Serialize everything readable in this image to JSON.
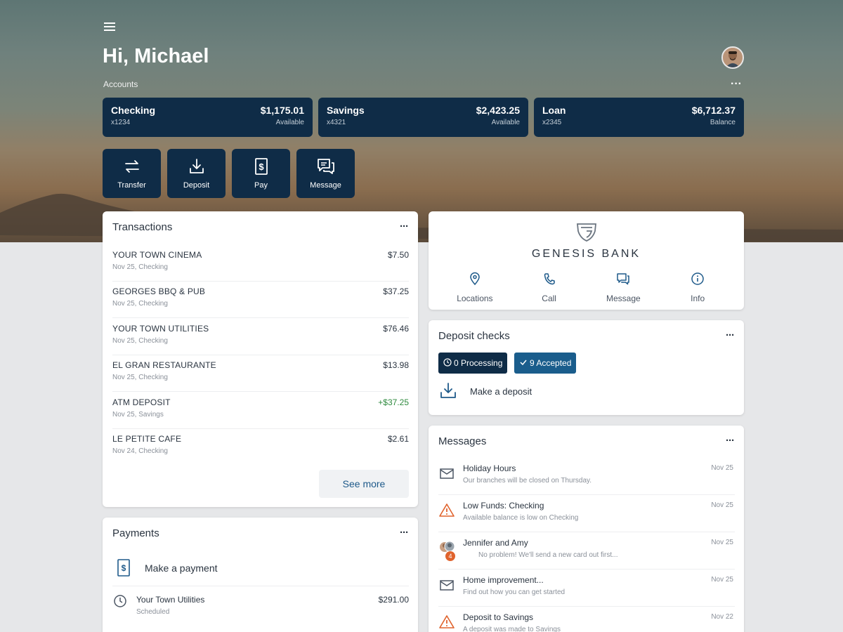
{
  "header": {
    "greeting": "Hi, Michael",
    "accounts_label": "Accounts",
    "more": "···"
  },
  "accounts": [
    {
      "name": "Checking",
      "number": "x1234",
      "amount": "$1,175.01",
      "sub": "Available"
    },
    {
      "name": "Savings",
      "number": "x4321",
      "amount": "$2,423.25",
      "sub": "Available"
    },
    {
      "name": "Loan",
      "number": "x2345",
      "amount": "$6,712.37",
      "sub": "Balance"
    }
  ],
  "actions": [
    {
      "label": "Transfer",
      "icon": "transfer-icon"
    },
    {
      "label": "Deposit",
      "icon": "deposit-icon"
    },
    {
      "label": "Pay",
      "icon": "pay-icon"
    },
    {
      "label": "Message",
      "icon": "message-icon"
    }
  ],
  "transactions": {
    "title": "Transactions",
    "more": "···",
    "items": [
      {
        "name": "YOUR TOWN CINEMA",
        "sub": "Nov 25, Checking",
        "amount": "$7.50"
      },
      {
        "name": "GEORGES BBQ & PUB",
        "sub": "Nov 25, Checking",
        "amount": "$37.25"
      },
      {
        "name": "YOUR TOWN UTILITIES",
        "sub": "Nov 25, Checking",
        "amount": "$76.46"
      },
      {
        "name": "EL GRAN RESTAURANTE",
        "sub": "Nov 25, Checking",
        "amount": "$13.98"
      },
      {
        "name": "ATM DEPOSIT",
        "sub": "Nov 25, Savings",
        "amount": "+$37.25"
      },
      {
        "name": "LE PETITE CAFE",
        "sub": "Nov 24, Checking",
        "amount": "$2.61"
      }
    ],
    "see_more": "See more"
  },
  "payments": {
    "title": "Payments",
    "more": "···",
    "make_payment": "Make a payment",
    "items": [
      {
        "name": "Your Town Utilities",
        "sub": "Scheduled",
        "amount": "$291.00"
      }
    ]
  },
  "bank": {
    "name": "GENESIS BANK",
    "links": [
      {
        "label": "Locations",
        "icon": "location-pin-icon"
      },
      {
        "label": "Call",
        "icon": "phone-icon"
      },
      {
        "label": "Message",
        "icon": "chat-icon"
      },
      {
        "label": "Info",
        "icon": "info-icon"
      }
    ]
  },
  "deposit_checks": {
    "title": "Deposit checks",
    "more": "···",
    "processing": "0 Processing",
    "accepted": "9 Accepted",
    "make_deposit": "Make a deposit"
  },
  "messages": {
    "title": "Messages",
    "more": "···",
    "items": [
      {
        "title": "Holiday Hours",
        "sub": "Our branches will be closed on Thursday.",
        "date": "Nov 25",
        "icon": "envelope-icon"
      },
      {
        "title": "Low Funds: Checking",
        "sub": "Available balance is low on Checking",
        "date": "Nov 25",
        "icon": "warning-icon"
      },
      {
        "title": "Jennifer and Amy",
        "sub": "No problem! We'll send a new card out first...",
        "date": "Nov 25",
        "icon": "group-avatar-icon",
        "unread": "4"
      },
      {
        "title": "Home improvement...",
        "sub": "Find out how you can get started",
        "date": "Nov 25",
        "icon": "envelope-icon"
      },
      {
        "title": "Deposit to Savings",
        "sub": "A deposit was made to Savings",
        "date": "Nov 22",
        "icon": "warning-icon"
      }
    ]
  },
  "colors": {
    "navy": "#0f2c47",
    "accepted_blue": "#1a5d8c",
    "positive_green": "#2e8a3e",
    "warning_orange": "#e0632d",
    "link_blue": "#1e5a8a"
  }
}
